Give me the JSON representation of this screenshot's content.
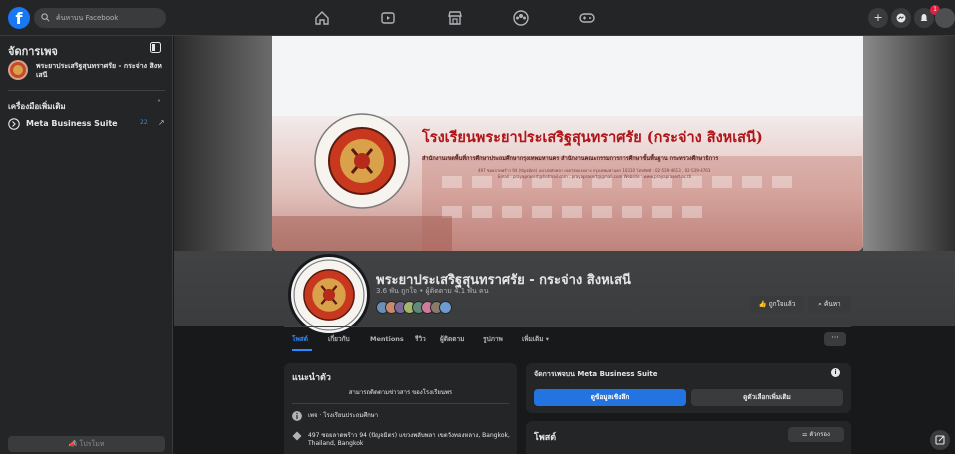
{
  "topbar": {
    "logo": "f",
    "search_placeholder": "ค้นหาบน Facebook",
    "nav_icons": [
      "home-icon",
      "watch-icon",
      "marketplace-icon",
      "groups-icon",
      "gaming-icon"
    ],
    "right_buttons": {
      "create": "+",
      "badge_count": "1"
    }
  },
  "sidebar": {
    "title": "จัดการเพจ",
    "page_name": "พระยาประเสริฐสุนทราศรัย - กระจ่าง สิงหเสนี",
    "tools_title": "เครื่องมือเพิ่มเติม",
    "tools": [
      {
        "label": "Meta Business Suite",
        "count": "22"
      }
    ],
    "promote_label": "โปรโมท"
  },
  "cover": {
    "title": "โรงเรียนพระยาประเสริฐสุนทราศรัย (กระจ่าง สิงหเสนี)",
    "sub1": "สำนักงานเขตพื้นที่การศึกษาประถมศึกษากรุงเทพมหานคร สำนักงานคณะกรรมการการศึกษาขั้นพื้นฐาน กระทรวงศึกษาธิการ",
    "sub2": "497 ซอยลาดพร้าว 94 (ปัญจมิตร) แขวงพลับพลา เขตวังทองหลาง กรุงเทพมหานคร 10310 โทรศัพท์ : 02-539-4613 , 02-539-4763",
    "sub3": "Email : prayaprasert@hotmail.com , prayaprasert@gmail.com  Website : www.prayaprasert.ac.th"
  },
  "profile": {
    "name": "พระยาประเสริฐสุนทราศรัย - กระจ่าง สิงหเสนี",
    "stats": "3.6 พัน ถูกใจ • ผู้ติดตาม 4.1 พัน คน",
    "liked_label": "ถูกใจแล้ว",
    "search_label": "ค้นหา"
  },
  "tabs": [
    {
      "label": "โพสต์",
      "active": true
    },
    {
      "label": "เกี่ยวกับ"
    },
    {
      "label": "Mentions"
    },
    {
      "label": "รีวิว"
    },
    {
      "label": "ผู้ติดตาม"
    },
    {
      "label": "รูปภาพ"
    },
    {
      "label": "เพิ่มเติม ▾"
    }
  ],
  "tabs_more": "···",
  "intro": {
    "title": "แนะนำตัว",
    "bio": "สามารถติดตามข่าวสาร ของโรงเรียนพร",
    "category": "เพจ · โรงเรียนประถมศึกษา",
    "address": "497 ซอยลาดพร้าว 94 (ปัญจมิตร) แขวงพลับพลา เขตวังทองหลาง, Bangkok, Thailand, Bangkok"
  },
  "mbs_card": {
    "title": "จัดการเพจบน Meta Business Suite",
    "btn_primary": "ดูข้อมูลเชิงลึก",
    "btn_secondary": "ดูตัวเลือกเพิ่มเติม"
  },
  "posts": {
    "title": "โพสต์",
    "filter_label": "ตัวกรอง"
  },
  "colors": {
    "accent": "#2d88ff",
    "primary_button": "#2374e1",
    "cover_title": "#b01418",
    "background": "#18191a",
    "card": "#242526"
  }
}
